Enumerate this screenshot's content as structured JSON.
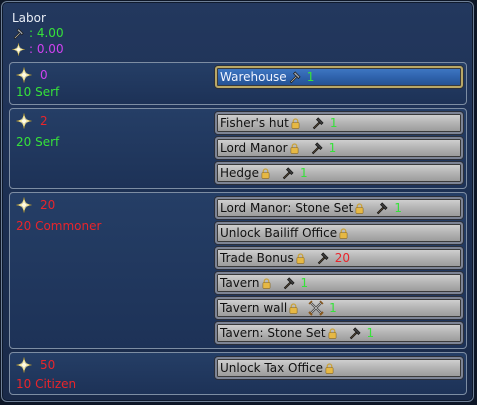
{
  "title": "Labor",
  "stats": {
    "labor_value": ": 4.00",
    "prestige_value": ": 0.00"
  },
  "sections": [
    {
      "req": "0",
      "class_label": "10 Serf",
      "buttons": [
        {
          "label": "Warehouse",
          "num": "1"
        }
      ]
    },
    {
      "req": "2",
      "class_label": "20 Serf",
      "buttons": [
        {
          "label": "Fisher's hut",
          "num": "1"
        },
        {
          "label": "Lord Manor",
          "num": "1"
        },
        {
          "label": "Hedge",
          "num": "1"
        }
      ]
    },
    {
      "req": "20",
      "class_label": "20 Commoner",
      "buttons": [
        {
          "label": "Lord Manor: Stone Set",
          "num": "1"
        },
        {
          "label": "Unlock Bailiff Office"
        },
        {
          "label": "Trade Bonus",
          "num": "20"
        },
        {
          "label": "Tavern",
          "num": "1"
        },
        {
          "label": "Tavern wall",
          "num": "1"
        },
        {
          "label": "Tavern: Stone Set",
          "num": "1"
        }
      ]
    },
    {
      "req": "50",
      "class_label": "10 Citizen",
      "buttons": [
        {
          "label": "Unlock Tax Office"
        }
      ]
    }
  ],
  "icons": {
    "labor": "hammer-icon",
    "prestige": "sun-star-icon",
    "lock": "lock-icon",
    "military": "crossed-swords-icon"
  },
  "colors": {
    "green": "#36e23a",
    "red": "#e8252b",
    "purple": "#d042f0",
    "active_button": "#2f63ad"
  }
}
